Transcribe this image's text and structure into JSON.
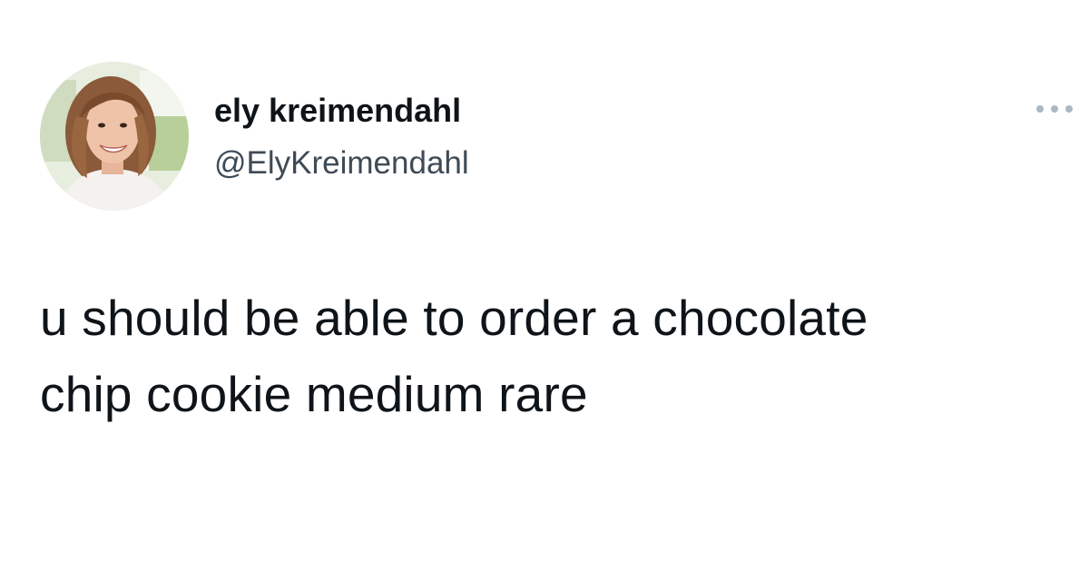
{
  "tweet": {
    "author": {
      "display_name": "ely kreimendahl",
      "handle": "@ElyKreimendahl",
      "avatar_icon": "profile-photo"
    },
    "more_icon": "more-dots-icon",
    "text_lines": [
      "u should be able to order a chocolate",
      "chip cookie medium rare"
    ]
  },
  "colors": {
    "background": "#ffffff",
    "text_primary": "#0f1419",
    "text_secondary": "#3e4a55",
    "more_dots": "#aab8c2"
  }
}
